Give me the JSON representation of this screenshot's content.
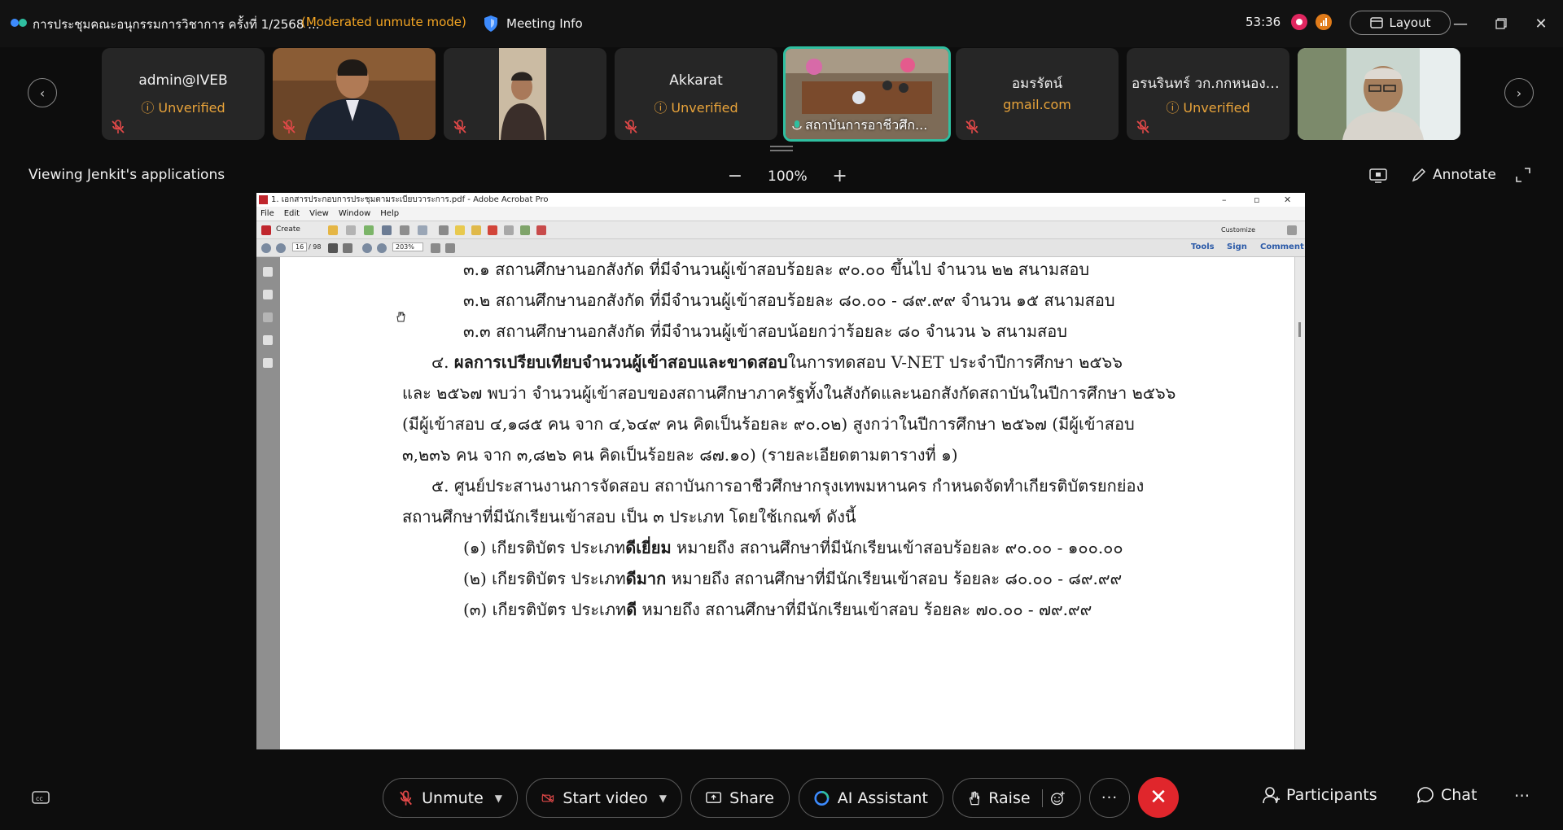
{
  "titlebar": {
    "meeting_title": "การประชุมคณะอนุกรรมการวิชาการ ครั้งที่ 1/2568 ...",
    "mode": "(Moderated unmute mode)",
    "meeting_info": "Meeting Info",
    "timer": "53:36",
    "layout": "Layout"
  },
  "participants": [
    {
      "name": "admin@IVEB",
      "sub": "Unverified"
    },
    {
      "name": "",
      "sub": ""
    },
    {
      "name": "",
      "sub": ""
    },
    {
      "name": "Akkarat",
      "sub": "Unverified"
    },
    {
      "name": "สถาบันการอาชีวศึก...",
      "sub": ""
    },
    {
      "name": "อมรรัตน์",
      "sub": "gmail.com"
    },
    {
      "name": "อรนรินทร์ วก.กกหนองจ...",
      "sub": "Unverified"
    },
    {
      "name": "",
      "sub": ""
    }
  ],
  "share": {
    "label": "Viewing Jenkit's applications",
    "zoom": "100%",
    "annotate": "Annotate"
  },
  "acrobat": {
    "title": "1. เอกสารประกอบการประชุมตามระเบียบวาระการ.pdf - Adobe Acrobat Pro",
    "menu": [
      "File",
      "Edit",
      "View",
      "Window",
      "Help"
    ],
    "create": "Create",
    "customize": "Customize",
    "page_current": "16",
    "page_total": "/ 98",
    "zoom": "203%",
    "tools": "Tools",
    "sign": "Sign",
    "comment": "Comment"
  },
  "doc_lines": [
    {
      "text": "๓.๑ สถานศึกษานอกสังกัด  ที่มีจำนวนผู้เข้าสอบร้อยละ ๙๐.๐๐ ขึ้นไป        จำนวน ๒๒ สนามสอบ"
    },
    {
      "text": "๓.๒ สถานศึกษานอกสังกัด  ที่มีจำนวนผู้เข้าสอบร้อยละ ๘๐.๐๐ - ๘๙.๙๙   จำนวน ๑๕ สนามสอบ"
    },
    {
      "text": "๓.๓ สถานศึกษานอกสังกัด  ที่มีจำนวนผู้เข้าสอบน้อยกว่าร้อยละ ๘๐          จำนวน ๖ สนามสอบ"
    },
    {
      "pre": "๔. ",
      "bold": "ผลการเปรียบเทียบจำนวนผู้เข้าสอบและขาดสอบ",
      "post": "ในการทดสอบ V-NET ประจำปีการศึกษา ๒๕๖๖"
    },
    {
      "text": "และ ๒๕๖๗ พบว่า จำนวนผู้เข้าสอบของสถานศึกษาภาครัฐทั้งในสังกัดและนอกสังกัดสถาบันในปีการศึกษา ๒๕๖๖"
    },
    {
      "text": "(มีผู้เข้าสอบ ๔,๑๘๕ คน จาก ๔,๖๔๙ คน คิดเป็นร้อยละ ๙๐.๐๒) สูงกว่าในปีการศึกษา ๒๕๖๗ (มีผู้เข้าสอบ"
    },
    {
      "text": "๓,๒๓๖ คน จาก ๓,๘๒๖ คน คิดเป็นร้อยละ ๘๗.๑๐) (รายละเอียดตามตารางที่ ๑)"
    },
    {
      "text": "๕. ศูนย์ประสานงานการจัดสอบ สถาบันการอาชีวศึกษากรุงเทพมหานคร กำหนดจัดทำเกียรติบัตรยกย่อง"
    },
    {
      "text": "สถานศึกษาที่มีนักเรียนเข้าสอบ เป็น ๓ ประเภท โดยใช้เกณฑ์ ดังนี้"
    },
    {
      "pre": "(๑) เกียรติบัตร ประเภท",
      "bold": "ดีเยี่ยม",
      "post": " หมายถึง สถานศึกษาที่มีนักเรียนเข้าสอบร้อยละ ๙๐.๐๐ - ๑๐๐.๐๐"
    },
    {
      "pre": "(๒) เกียรติบัตร ประเภท",
      "bold": "ดีมาก",
      "post": "  หมายถึง สถานศึกษาที่มีนักเรียนเข้าสอบ ร้อยละ ๘๐.๐๐ - ๘๙.๙๙"
    },
    {
      "pre": "(๓) เกียรติบัตร ประเภท",
      "bold": "ดี",
      "post": "  หมายถึง สถานศึกษาที่มีนักเรียนเข้าสอบ ร้อยละ ๗๐.๐๐ - ๗๙.๙๙"
    }
  ],
  "toolbar": {
    "unmute": "Unmute",
    "start_video": "Start video",
    "share": "Share",
    "ai_assistant": "AI Assistant",
    "raise": "Raise",
    "participants": "Participants",
    "chat": "Chat"
  },
  "colors": {
    "accent_orange": "#f5a623",
    "active_tile": "#2fbfa0",
    "end_call": "#e0262c",
    "mute_red": "#e04848"
  },
  "icons": [
    "app-logo-icon",
    "shield-icon",
    "record-icon",
    "signal-icon",
    "layout-icon",
    "minimize-icon",
    "restore-icon",
    "close-icon",
    "chevron-left-icon",
    "chevron-right-icon",
    "mic-off-icon",
    "screen-icon",
    "annotate-icon",
    "expand-icon",
    "video-off-icon",
    "share-icon",
    "ai-icon",
    "hand-icon",
    "emoji-icon",
    "more-icon",
    "end-call-icon",
    "participants-icon",
    "chat-icon",
    "captions-icon"
  ]
}
